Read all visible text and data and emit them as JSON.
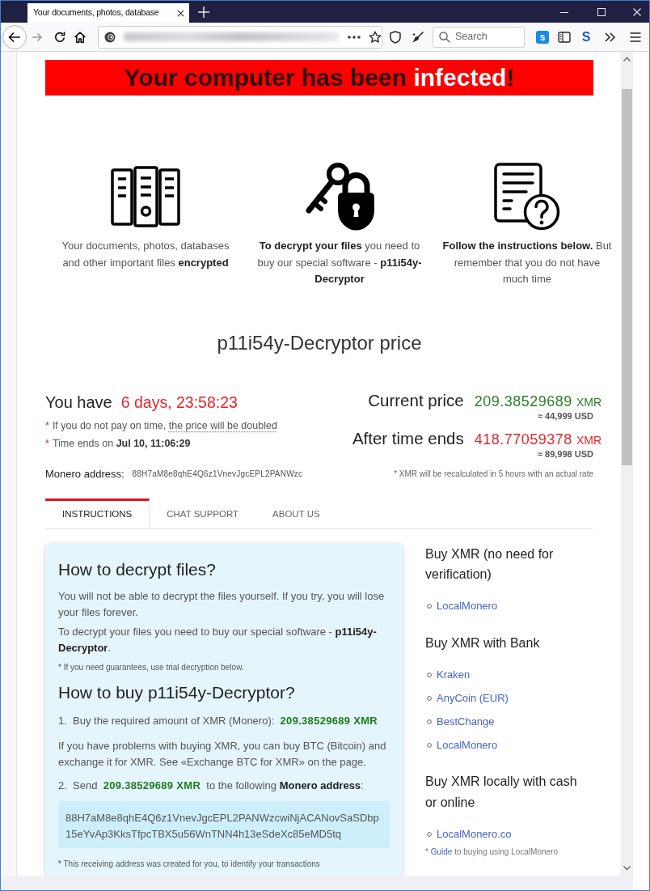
{
  "browser": {
    "tab_title": "Your documents, photos, database",
    "search_placeholder": "Search",
    "extensions": [
      {
        "kind": "tile",
        "text": "s"
      },
      {
        "kind": "sidebar"
      },
      {
        "kind": "letter",
        "text": "S"
      }
    ]
  },
  "banner": {
    "segments": [
      {
        "text": "Your computer has been ",
        "highlight": false
      },
      {
        "text": "infected",
        "highlight": true
      },
      {
        "text": "!",
        "highlight": false
      }
    ]
  },
  "features": [
    {
      "text": "Your documents, photos, databases and other important files **encrypted**"
    },
    {
      "text": "**To decrypt your files** you need to buy our special software - **p11i54y-Decryptor**"
    },
    {
      "text": "**Follow the instructions below.** But remember that you do not have much time"
    }
  ],
  "price": {
    "title": "p11i54y-Decryptor price",
    "countdown_label": "You have",
    "countdown": "6 days, 23:58:23",
    "notes": [
      {
        "mark": "*",
        "text": "If you do not pay on time,",
        "hint": "the price will be doubled"
      },
      {
        "mark": "*",
        "text": "Time ends on **Jul 10, 11:06:29**"
      }
    ],
    "rows": [
      {
        "label": "Current price",
        "amount": "209.38529689",
        "unit": "XMR",
        "usd": "≈ 44,999 USD",
        "color": "#2a7d2a"
      },
      {
        "label": "After time ends",
        "amount": "418.77059378",
        "unit": "XMR",
        "usd": "≈ 89,998 USD",
        "color": "#e3262b"
      }
    ],
    "address_label": "Monero address:",
    "address": "88H7aM8e8qhE4Q6z1VnevJgcEPL2PANWzc",
    "rate_note": "* XMR will be recalculated in 5 hours with an actual rate"
  },
  "tabs": [
    {
      "label": "INSTRUCTIONS",
      "selected": true
    },
    {
      "label": "CHAT SUPPORT",
      "selected": false
    },
    {
      "label": "ABOUT US",
      "selected": false
    }
  ],
  "instructions": [
    {
      "kind": "heading",
      "text": "How to decrypt files?"
    },
    {
      "kind": "paragraph",
      "text": "You will not be able to decrypt the files yourself. If you try, you will lose your files forever."
    },
    {
      "kind": "paragraph",
      "text": "To decrypt your files you need to buy our special software - **p11i54y-Decryptor**."
    },
    {
      "kind": "note",
      "text": "* If you need guarantees, use trial decryption below."
    },
    {
      "kind": "heading",
      "text": "How to buy p11i54y-Decryptor?"
    },
    {
      "kind": "step",
      "number": "1.",
      "text": "Buy the required amount of XMR (Monero):",
      "amount": "209.38529689 XMR"
    },
    {
      "kind": "paragraph",
      "text": "If you have problems with buying XMR, you can buy BTC (Bitcoin) and exchange it for XMR. See «Exchange BTC for XMR» on the page."
    },
    {
      "kind": "step",
      "number": "2.",
      "text": "Send",
      "amount": "209.38529689 XMR",
      "after": "to the following **Monero address**:"
    },
    {
      "kind": "address",
      "text": "88H7aM8e8qhE4Q6z1VnevJgcEPL2PANWzcwiNjACANovSaSDbp15eYvAp3KksTfpcTBX5u56WnTNN4h13eSdeXc85eMD5tq"
    },
    {
      "kind": "note",
      "text": "* This receiving address was created for you, to identify your transactions"
    }
  ],
  "sidebar": [
    {
      "heading": "Buy XMR (no need for verification)",
      "links": [
        "LocalMonero"
      ]
    },
    {
      "heading": "Buy XMR with Bank",
      "links": [
        "Kraken",
        "AnyCoin (EUR)",
        "BestChange",
        "LocalMonero"
      ]
    },
    {
      "heading": "Buy XMR locally with cash or online",
      "links": [
        "LocalMonero.co"
      ],
      "note": {
        "mark": "*",
        "link": "Guide",
        "text": "to buying using LocalMonero"
      }
    }
  ]
}
